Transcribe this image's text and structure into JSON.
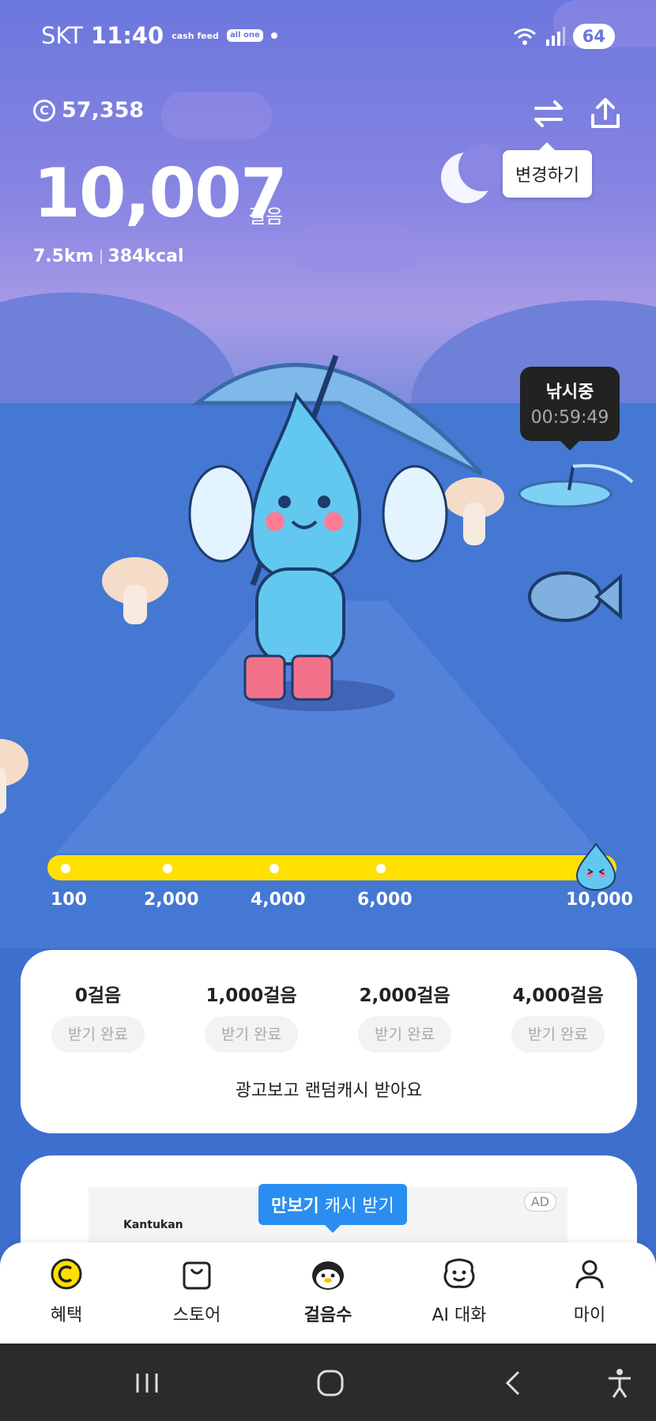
{
  "status_bar": {
    "carrier": "SKT",
    "time": "11:40",
    "cash_feed": "cash feed",
    "app_badge": "all one",
    "battery": "64"
  },
  "header": {
    "coin_symbol": "C",
    "coin_balance": "57,358",
    "change_tooltip": "변경하기"
  },
  "steps": {
    "count": "10,007",
    "unit": "걸음",
    "distance": "7.5km",
    "calories": "384kcal"
  },
  "fishing": {
    "title": "낚시중",
    "timer": "00:59:49"
  },
  "progress": {
    "labels": [
      "100",
      "2,000",
      "4,000",
      "6,000",
      "10,000"
    ],
    "value_fraction": 1.0
  },
  "rewards": {
    "milestones": [
      {
        "label": "0걸음",
        "status": "받기 완료"
      },
      {
        "label": "1,000걸음",
        "status": "받기 완료"
      },
      {
        "label": "2,000걸음",
        "status": "받기 완료"
      },
      {
        "label": "4,000걸음",
        "status": "받기 완료"
      }
    ],
    "ad_text": "광고보고 랜덤캐시 받아요"
  },
  "ad_card": {
    "brand": "Kantukan",
    "ad_label": "AD",
    "tip_bold": "만보기",
    "tip_rest": " 캐시 받기"
  },
  "bottom_nav": [
    {
      "label": "혜택",
      "icon": "coin-icon"
    },
    {
      "label": "스토어",
      "icon": "shopping-bag-icon"
    },
    {
      "label": "걸음수",
      "icon": "penguin-icon"
    },
    {
      "label": "AI 대화",
      "icon": "chat-face-icon"
    },
    {
      "label": "마이",
      "icon": "person-icon"
    }
  ],
  "colors": {
    "accent_yellow": "#ffe000",
    "tip_blue": "#2a8ef0",
    "sky_top": "#6b77dd",
    "ground_blue": "#3d6fcf"
  }
}
